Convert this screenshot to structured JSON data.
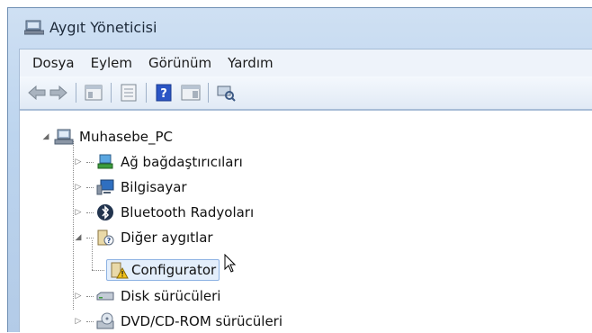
{
  "window": {
    "title": "Aygıt Yöneticisi"
  },
  "menu": [
    "Dosya",
    "Eylem",
    "Görünüm",
    "Yardım"
  ],
  "toolbar": {
    "icons": [
      "back-icon",
      "forward-icon",
      "show-hide-console-tree-icon",
      "properties-icon",
      "help-icon",
      "action-pane-icon",
      "scan-hardware-icon"
    ]
  },
  "tree": {
    "root": {
      "label": "Muhasebe_PC",
      "icon": "computer-network-icon",
      "expanded": true
    },
    "items": [
      {
        "label": "Ağ bağdaştırıcıları",
        "icon": "network-adapter-icon",
        "expanded": false
      },
      {
        "label": "Bilgisayar",
        "icon": "computer-icon",
        "expanded": false
      },
      {
        "label": "Bluetooth Radyoları",
        "icon": "bluetooth-icon",
        "expanded": false
      },
      {
        "label": "Diğer aygıtlar",
        "icon": "unknown-device-icon",
        "expanded": true,
        "children": [
          {
            "label": "Configurator",
            "icon": "warning-device-icon",
            "selected": true
          }
        ]
      },
      {
        "label": "Disk sürücüleri",
        "icon": "disk-drive-icon",
        "expanded": false
      },
      {
        "label": "DVD/CD-ROM sürücüleri",
        "icon": "dvd-drive-icon",
        "expanded": false
      }
    ]
  }
}
